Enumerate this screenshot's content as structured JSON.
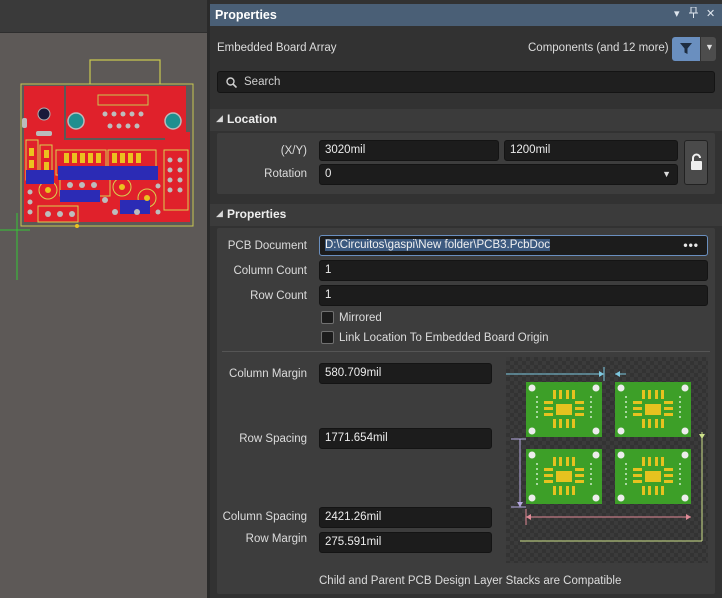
{
  "panel": {
    "title": "Properties",
    "header_buttons": [
      "▾",
      "✕"
    ],
    "object_type": "Embedded Board Array",
    "filter_label": "Components (and 12 more)",
    "search_placeholder": "Search"
  },
  "location": {
    "title": "Location",
    "xy_label": "(X/Y)",
    "x_value": "3020mil",
    "y_value": "1200mil",
    "rotation_label": "Rotation",
    "rotation_value": "0"
  },
  "properties": {
    "title": "Properties",
    "pcb_document_label": "PCB Document",
    "pcb_document_value": "D:\\Circuitos\\gaspi\\New folder\\PCB3.PcbDoc",
    "column_count_label": "Column Count",
    "column_count_value": "1",
    "row_count_label": "Row Count",
    "row_count_value": "1",
    "mirrored_label": "Mirrored",
    "mirrored_checked": false,
    "link_location_label": "Link Location To Embedded Board Origin",
    "link_location_checked": false,
    "column_margin_label": "Column Margin",
    "column_margin_value": "580.709mil",
    "row_spacing_label": "Row Spacing",
    "row_spacing_value": "1771.654mil",
    "column_spacing_label": "Column Spacing",
    "column_spacing_value": "2421.26mil",
    "row_margin_label": "Row Margin",
    "row_margin_value": "275.591mil",
    "status_message": "Child and Parent PCB Design Layer Stacks are Compatible"
  },
  "colors": {
    "header_blue": "#4a5f76",
    "filter_button": "#6a8fbf",
    "pcb_red": "#e0212b",
    "board_green": "#3d9f28",
    "pad_gold": "#e6c21f"
  }
}
